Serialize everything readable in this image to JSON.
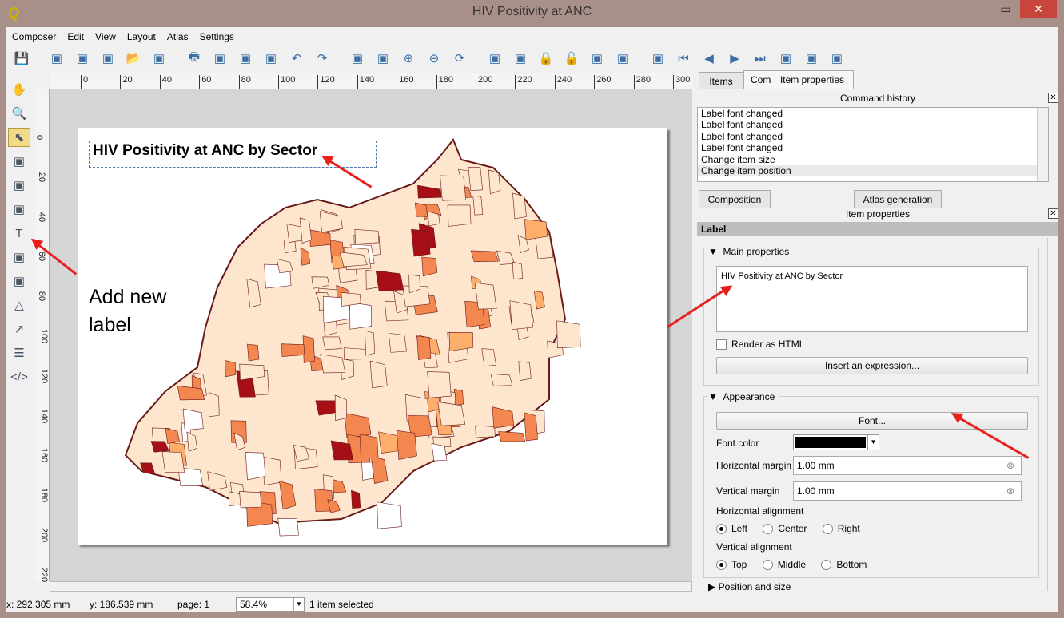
{
  "window": {
    "title": "HIV Positivity at ANC",
    "controls": [
      "minimize",
      "maximize",
      "close"
    ]
  },
  "menu": [
    "Composer",
    "Edit",
    "View",
    "Layout",
    "Atlas",
    "Settings"
  ],
  "toolbar": [
    "save-icon",
    "new-composer-icon",
    "duplicate-composer-icon",
    "composer-manager-icon",
    "open-template-icon",
    "save-template-icon",
    "print-icon",
    "export-image-icon",
    "export-svg-icon",
    "export-pdf-icon",
    "undo-icon",
    "redo-icon",
    "zoom-full-icon",
    "zoom-actual-icon",
    "zoom-in-icon",
    "zoom-out-icon",
    "refresh-icon",
    "group-icon",
    "ungroup-icon",
    "lock-icon",
    "unlock-icon",
    "raise-icon",
    "align-icon",
    "atlas-preview-icon",
    "first-feature-icon",
    "prev-feature-icon",
    "next-feature-icon",
    "last-feature-icon",
    "atlas-print-icon",
    "atlas-export-icon",
    "atlas-settings-icon"
  ],
  "left_tools": [
    "pan-icon",
    "zoom-tool-icon",
    "select-move-icon",
    "move-content-icon",
    "add-map-icon",
    "add-image-icon",
    "add-label-icon",
    "add-legend-icon",
    "add-scalebar-icon",
    "add-shape-icon",
    "add-arrow-icon",
    "add-table-icon",
    "add-html-icon"
  ],
  "ruler": {
    "h": [
      "0",
      "20",
      "40",
      "60",
      "80",
      "100",
      "120",
      "140",
      "160",
      "180",
      "200",
      "220",
      "240",
      "260",
      "280",
      "300"
    ],
    "v": [
      "0",
      "20",
      "40",
      "60",
      "80",
      "100",
      "120",
      "140",
      "160",
      "180",
      "200",
      "220"
    ]
  },
  "page": {
    "label_text": "HIV Positivity at ANC by Sector",
    "annotation": "Add new\nlabel"
  },
  "map_colors": {
    "light": "#fee6ce",
    "mid": "#fdae6b",
    "orange": "#f4874f",
    "dark": "#a50f15",
    "none": "#ffffff",
    "border": "#6b1a1a"
  },
  "status": {
    "x": "x: 292.305 mm",
    "y": "y: 186.539 mm",
    "page": "page: 1",
    "zoom": "58.4%",
    "selection": "1 item selected"
  },
  "right_panel": {
    "top_tabs": [
      "Items",
      "Command history"
    ],
    "history_title": "Command history",
    "history": [
      "Label font changed",
      "Label font changed",
      "Label font changed",
      "Label font changed",
      "Change item size",
      "Change item position"
    ],
    "bottom_tabs": [
      "Composition",
      "Item properties",
      "Atlas generation"
    ],
    "props_title": "Item properties",
    "section": "Label",
    "main_properties": "Main properties",
    "label_text": "HIV Positivity at ANC by Sector",
    "render_html": "Render as HTML",
    "insert_expression": "Insert an expression...",
    "appearance": "Appearance",
    "font_button": "Font...",
    "font_color_label": "Font color",
    "font_color": "#000000",
    "h_margin_label": "Horizontal margin",
    "h_margin": "1.00 mm",
    "v_margin_label": "Vertical margin",
    "v_margin": "1.00 mm",
    "h_align_label": "Horizontal alignment",
    "h_align": [
      "Left",
      "Center",
      "Right"
    ],
    "v_align_label": "Vertical alignment",
    "v_align": [
      "Top",
      "Middle",
      "Bottom"
    ],
    "next_section": "Position and size"
  }
}
